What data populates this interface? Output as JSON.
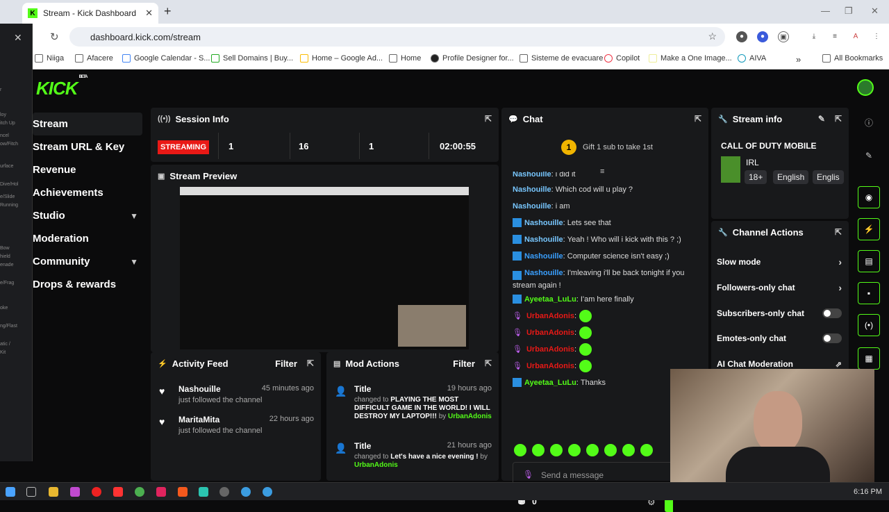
{
  "browser": {
    "tab_title": "Stream - Kick Dashboard",
    "url": "dashboard.kick.com/stream",
    "bookmarks": [
      "Niiga",
      "Afacere",
      "Google Calendar - S...",
      "Sell Domains | Buy...",
      "Home – Google Ad...",
      "Home",
      "Profile Designer for...",
      "Sisteme de evacuare",
      "Copilot",
      "Make a One Image...",
      "AIVA",
      "All Bookmarks"
    ]
  },
  "overlay": {
    "items": [
      "r",
      "loy",
      "itch Up",
      "ncel",
      "ow/Fitch",
      "urface",
      "Dive/Hol",
      "e/Slide",
      "Running",
      "Bow",
      "hield",
      "enade",
      "e/Frag",
      "oke",
      "ng/Flast",
      "atic /",
      "Kit"
    ]
  },
  "brand": {
    "logo": "KICK",
    "beta": "BETA"
  },
  "nav": {
    "items": [
      {
        "label": "Stream"
      },
      {
        "label": "Stream URL & Key"
      },
      {
        "label": "Revenue"
      },
      {
        "label": "Achievements"
      },
      {
        "label": "Studio"
      },
      {
        "label": "Moderation"
      },
      {
        "label": "Community"
      },
      {
        "label": "Drops & rewards"
      }
    ]
  },
  "session": {
    "title": "Session Info",
    "status": "STREAMING",
    "stats": [
      "1",
      "16",
      "1",
      "02:00:55"
    ]
  },
  "preview": {
    "title": "Stream Preview"
  },
  "activity": {
    "title": "Activity Feed",
    "filter": "Filter",
    "items": [
      {
        "name": "Nashouille",
        "time": "45 minutes ago",
        "sub": "just followed the channel"
      },
      {
        "name": "MaritaMita",
        "time": "22 hours ago",
        "sub": "just followed the channel"
      }
    ]
  },
  "mod": {
    "title": "Mod Actions",
    "filter": "Filter",
    "items": [
      {
        "title": "Title",
        "time": "19 hours ago",
        "changed": "changed to",
        "value": "PLAYING THE MOST DIFFICULT GAME IN THE WORLD! I WILL DESTROY MY LAPTOP!!!",
        "by": "by",
        "user": "UrbanAdonis"
      },
      {
        "title": "Title",
        "time": "21 hours ago",
        "changed": "changed to",
        "value": "Let's have a nice evening !",
        "by": "by",
        "user": "UrbanAdonis"
      }
    ]
  },
  "chat": {
    "title": "Chat",
    "gift_rank": "1",
    "gift_text": "Gift 1 sub to take 1st",
    "messages": [
      {
        "user": "Nashouille",
        "text": "i did it",
        "badge": false
      },
      {
        "user": "Nashouille",
        "text": "Which cod will u play ?",
        "badge": false
      },
      {
        "user": "Nashouille",
        "text": "i am",
        "badge": false
      },
      {
        "user": "Nashouille",
        "text": "Lets see that",
        "badge": true
      },
      {
        "user": "Nashouille",
        "text": "Yeah ! Who will i kick with this ? ;)",
        "badge": true
      },
      {
        "user": "Nashouille",
        "text": "Computer science isn't easy ;)",
        "badge": true
      },
      {
        "user": "Nashouille",
        "text": "I'mleaving i'll be back tonight if you",
        "badge": true
      },
      {
        "user": "",
        "text": "stream again !",
        "badge": false
      },
      {
        "user": "Ayeetaa_LuLu",
        "text": "I'am here finally",
        "badge": true
      },
      {
        "user": "UrbanAdonis",
        "text": "",
        "badge": false
      },
      {
        "user": "UrbanAdonis",
        "text": "",
        "badge": false
      },
      {
        "user": "UrbanAdonis",
        "text": "",
        "badge": false
      },
      {
        "user": "UrbanAdonis",
        "text": "",
        "badge": false
      },
      {
        "user": "Ayeetaa_LuLu",
        "text": "Thanks",
        "badge": true
      }
    ],
    "placeholder": "Send a message",
    "count": "0"
  },
  "stream_info": {
    "title": "Stream info",
    "category": "CALL OF DUTY MOBILE",
    "tag": "IRL",
    "chips": [
      "18+",
      "English",
      "Englis"
    ]
  },
  "channel_actions": {
    "title": "Channel Actions",
    "rows": [
      {
        "label": "Slow mode",
        "kind": "arrow"
      },
      {
        "label": "Followers-only chat",
        "kind": "arrow"
      },
      {
        "label": "Subscribers-only chat",
        "kind": "toggle"
      },
      {
        "label": "Emotes-only chat",
        "kind": "toggle"
      },
      {
        "label": "AI Chat Moderation",
        "kind": "link"
      }
    ]
  },
  "taskbar": {
    "clock": "6:16 PM"
  },
  "colors": {
    "brand": "#53fc18",
    "streaming": "#e91916",
    "panel": "#18191b"
  }
}
